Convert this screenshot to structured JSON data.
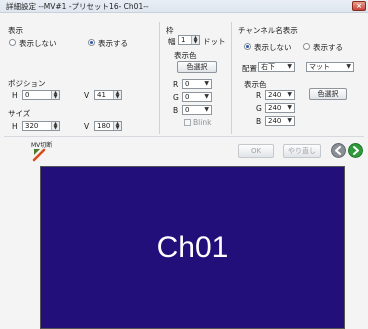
{
  "window": {
    "title": "詳細設定 --MV#1 -プリセット16- Ch01--",
    "close_label": "×"
  },
  "display": {
    "header": "表示",
    "hide_label": "表示しない",
    "show_label": "表示する",
    "selected": "show",
    "position_header": "ポジション",
    "h_label": "H",
    "h_value": "0",
    "v_label": "V",
    "v_value": "41",
    "size_header": "サイズ",
    "size_h_label": "H",
    "size_h_value": "320",
    "size_v_label": "V",
    "size_v_value": "180"
  },
  "frame": {
    "header": "枠",
    "width_label": "幅",
    "width_value": "1",
    "unit": "ドット",
    "display_color_label": "表示色",
    "color_select_button": "色選択",
    "r_label": "R",
    "r_value": "0",
    "g_label": "G",
    "g_value": "0",
    "b_label": "B",
    "b_value": "0",
    "blink_label": "Blink"
  },
  "channel_name": {
    "header": "チャンネル名表示",
    "hide_label": "表示しない",
    "show_label": "表示する",
    "selected": "hide",
    "position_label": "配置",
    "position_value": "右下",
    "style_value": "マット",
    "color_label": "表示色",
    "r_label": "R",
    "r_value": "240",
    "g_label": "G",
    "g_value": "240",
    "b_label": "B",
    "b_value": "240",
    "color_select_button": "色選択"
  },
  "bottom": {
    "mv_label": "MV切断",
    "ok_label": "OK",
    "undo_label": "やり直し",
    "preview_text": "Ch01"
  },
  "colors": {
    "preview_bg": "#230f7a",
    "back": "#8a8f96",
    "forward": "#2e9a3a"
  }
}
